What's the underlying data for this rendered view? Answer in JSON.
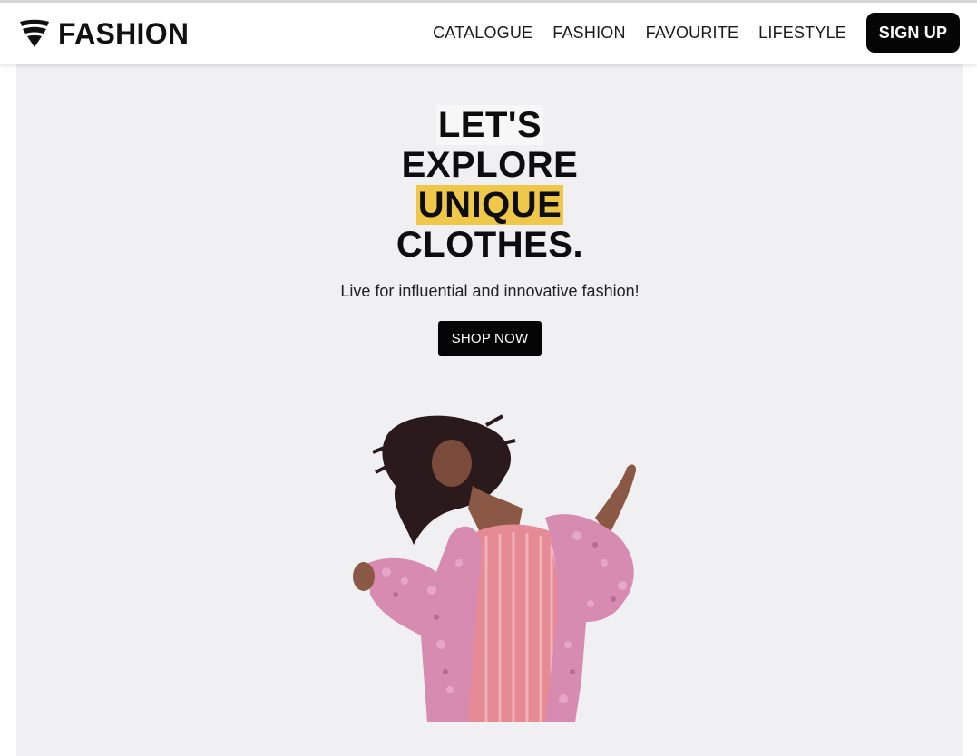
{
  "header": {
    "brand_name": "FASHION",
    "logo_icon": "layered-chevron-logo-icon",
    "nav": [
      {
        "label": "CATALOGUE"
      },
      {
        "label": "FASHION"
      },
      {
        "label": "FAVOURITE"
      },
      {
        "label": "LIFESTYLE"
      }
    ],
    "signup_label": "SIGN UP"
  },
  "hero": {
    "headline": [
      "LET'S",
      "EXPLORE",
      "UNIQUE",
      "CLOTHES."
    ],
    "tagline": "Live for influential and innovative fashion!",
    "cta_label": "SHOP NOW",
    "image": "woman-in-pink-fur-coat"
  },
  "colors": {
    "highlight": "#efc84a",
    "hero_background": "#f0f0f3",
    "button": "#050505",
    "coat": "#d88bb0",
    "jumpsuit": "#e68a96"
  }
}
